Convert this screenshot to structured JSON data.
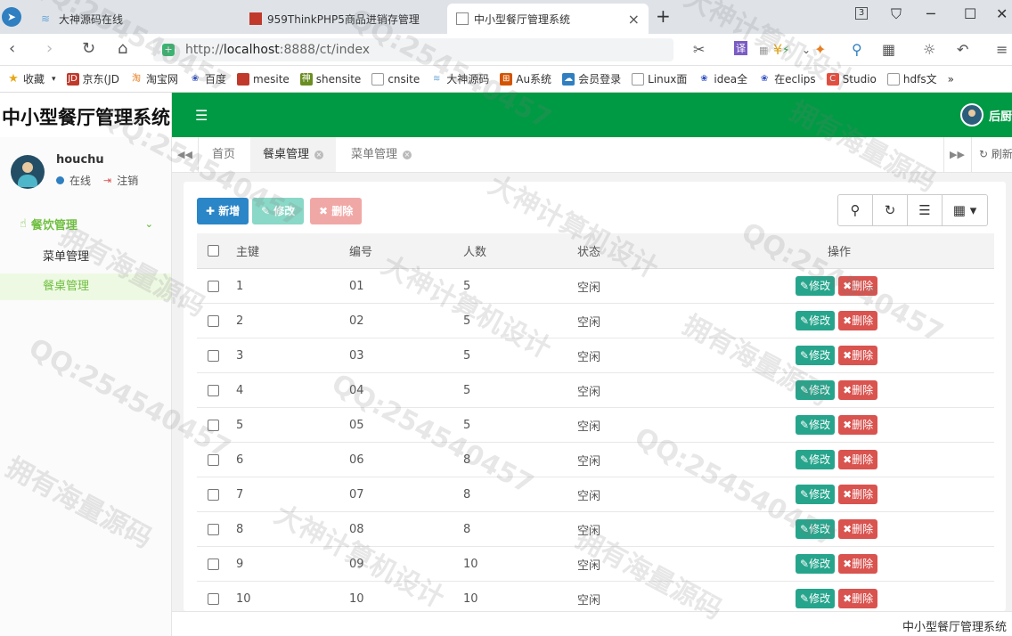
{
  "browser": {
    "tabs": [
      {
        "title": "大神源码在线"
      },
      {
        "title": "959ThinkPHP5商品进销存管理"
      },
      {
        "title": "中小型餐厅管理系统"
      }
    ],
    "url_prefix": "http://",
    "url_host": "localhost",
    "url_rest": ":8888/ct/index",
    "bookmarks": [
      "收藏",
      "京东(JD",
      "淘宝网",
      "百度",
      "mesite",
      "shensite",
      "cnsite",
      "大神源码",
      "Au系统",
      "会员登录",
      "Linux面",
      "idea全",
      "在eclips",
      "Studio",
      "hdfs文"
    ],
    "counter": "3"
  },
  "app": {
    "brand": "中小型餐厅管理系统",
    "top_user": "后厨",
    "user": {
      "name": "houchu",
      "online": "在线",
      "logout": "注销"
    },
    "menu": {
      "group": "餐饮管理",
      "items": [
        {
          "label": "菜单管理"
        },
        {
          "label": "餐桌管理"
        }
      ]
    },
    "tabs": [
      {
        "label": "首页"
      },
      {
        "label": "餐桌管理"
      },
      {
        "label": "菜单管理"
      }
    ],
    "refresh": "刷新",
    "toolbar": {
      "add": "新增",
      "edit": "修改",
      "delete": "删除"
    },
    "table": {
      "headers": {
        "id": "主键",
        "code": "编号",
        "people": "人数",
        "status": "状态",
        "actions": "操作"
      },
      "action_edit": "修改",
      "action_delete": "删除",
      "rows": [
        {
          "id": "1",
          "code": "01",
          "people": "5",
          "status": "空闲"
        },
        {
          "id": "2",
          "code": "02",
          "people": "5",
          "status": "空闲"
        },
        {
          "id": "3",
          "code": "03",
          "people": "5",
          "status": "空闲"
        },
        {
          "id": "4",
          "code": "04",
          "people": "5",
          "status": "空闲"
        },
        {
          "id": "5",
          "code": "05",
          "people": "5",
          "status": "空闲"
        },
        {
          "id": "6",
          "code": "06",
          "people": "8",
          "status": "空闲"
        },
        {
          "id": "7",
          "code": "07",
          "people": "8",
          "status": "空闲"
        },
        {
          "id": "8",
          "code": "08",
          "people": "8",
          "status": "空闲"
        },
        {
          "id": "9",
          "code": "09",
          "people": "10",
          "status": "空闲"
        },
        {
          "id": "10",
          "code": "10",
          "people": "10",
          "status": "空闲"
        }
      ]
    },
    "footer": "中小型餐厅管理系统"
  },
  "watermark": {
    "qq": "QQ:254540457",
    "a": "大神计算机设计",
    "b": "拥有海量源码"
  },
  "colors": {
    "topbar": "#009a44",
    "menu_active": "#6fbf3f",
    "add": "#2a86c7",
    "edit": "#27a58c",
    "delete": "#d9534f"
  }
}
